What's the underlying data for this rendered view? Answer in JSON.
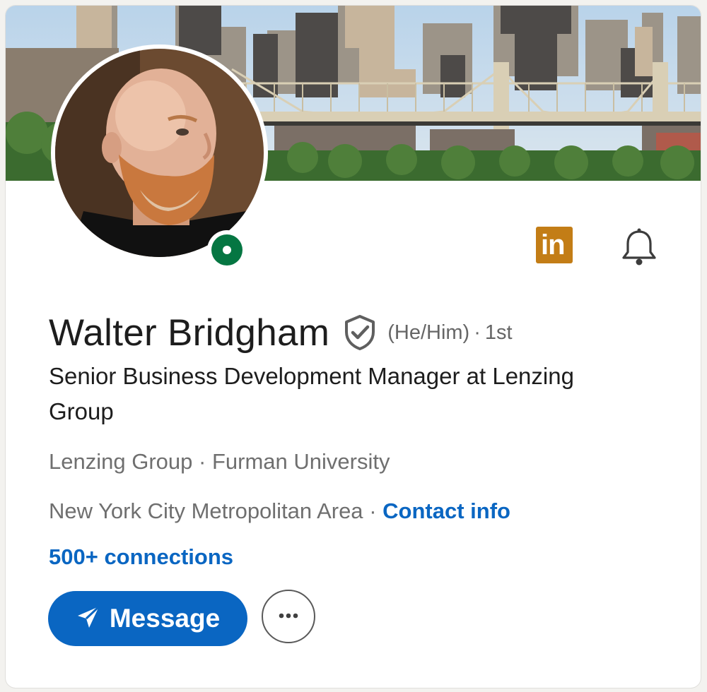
{
  "profile": {
    "name": "Walter Bridgham",
    "pronouns": "(He/Him)",
    "separator": "·",
    "degree": "1st",
    "headline": "Senior Business Development Manager at Lenzing Group",
    "company": "Lenzing Group",
    "education": "Furman University",
    "location": "New York City Metropolitan Area",
    "contact_info_label": "Contact info",
    "connections_label": "500+ connections",
    "status": "online"
  },
  "badges": {
    "linkedin_text": "in",
    "linkedin_color": "#c37d16"
  },
  "actions": {
    "message_label": "Message",
    "more_label": "···"
  },
  "colors": {
    "accent": "#0a66c2",
    "presence": "#057642",
    "text_primary": "#1d1d1d",
    "text_secondary": "#666666"
  },
  "icons": {
    "verified": "shield-check-icon",
    "notifications": "bell-icon",
    "message": "paper-plane-icon",
    "more": "ellipsis-icon"
  }
}
